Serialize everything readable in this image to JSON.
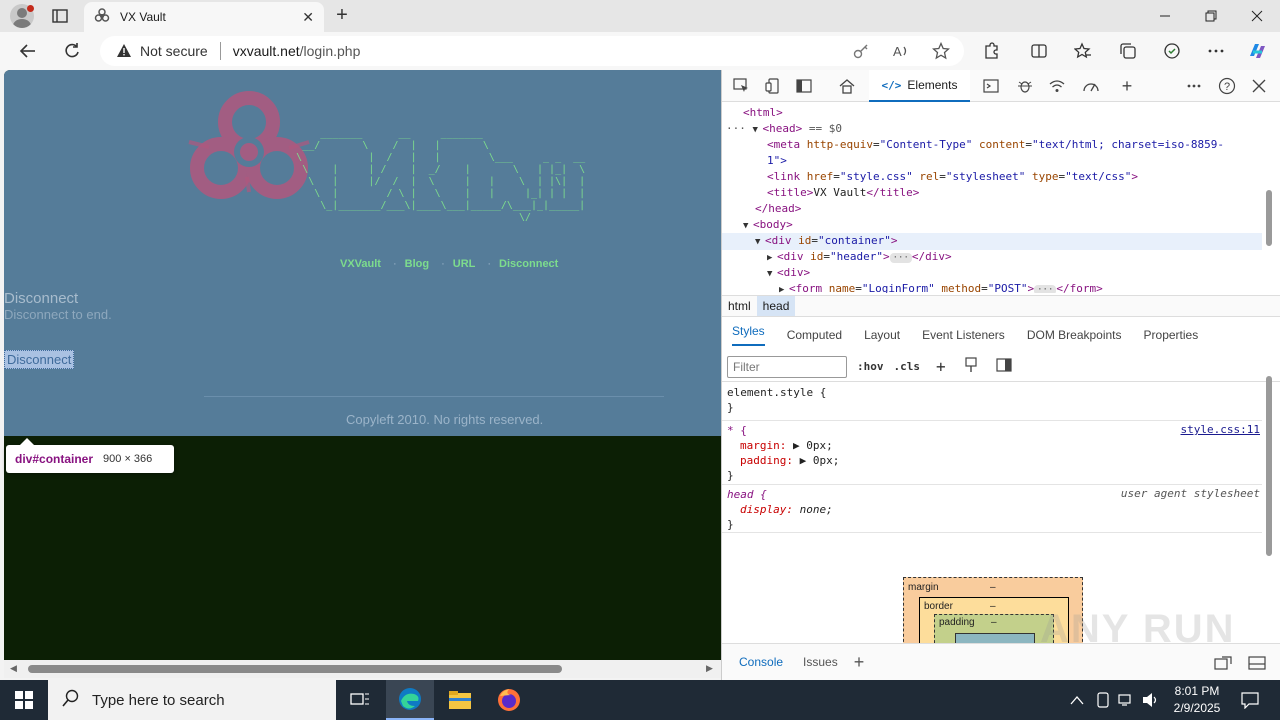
{
  "browser": {
    "tab_title": "VX Vault",
    "close_tab_glyph": "✕",
    "new_tab_glyph": "+",
    "security_label": "Not secure",
    "url_domain": "vxvault.net",
    "url_path": "/login.php"
  },
  "page": {
    "ascii_logo": "             _______      __     _______\n          __/       \\    /  |   |       \\\n         \\           |  /   |   |        \\___     _ _  __\n          \\    |     | /    |  _/    |       \\   | |_|  \\\n           \\   |     |/  /  |  \\     |   |    \\  | |\\|  |\n            \\  |        / \\ |   \\    |   |     |_| | |  |\n             \\_|_______/___\\|____\\___|_____/\\___|_|_____|\n                                              \\/",
    "nav": [
      "VXVault",
      "Blog",
      "URL",
      "Disconnect"
    ],
    "heading": "Disconnect",
    "subheading": "Disconnect to end.",
    "button": "Disconnect",
    "footer": "Copyleft 2010. No rights reserved.",
    "inspect_tooltip": {
      "tag": "div",
      "id": "#container",
      "dimensions": "900 × 366"
    }
  },
  "devtools": {
    "active_tab": "Elements",
    "dom_lines": {
      "html": "<html>",
      "head_eq": "== $0",
      "meta_equiv_value": "Content-Type",
      "meta_content_value": "text/html; charset=iso-8859-",
      "meta_cont": "1\">",
      "link_href": "style.css",
      "link_rel": "stylesheet",
      "link_type": "text/css",
      "title_text": "VX Vault",
      "div_container": "container",
      "div_header": "header",
      "form_name": "LoginForm",
      "form_method": "POST"
    },
    "breadcrumbs": [
      "html",
      "head"
    ],
    "style_tabs": [
      "Styles",
      "Computed",
      "Layout",
      "Event Listeners",
      "DOM Breakpoints",
      "Properties"
    ],
    "filter_placeholder": "Filter",
    "filter_opts": [
      ":hov",
      ".cls"
    ],
    "rules": {
      "element_style": "element.style {",
      "star_selector": "* {",
      "star_source": "style.css:11",
      "margin": "margin:",
      "margin_val": "0px;",
      "padding": "padding:",
      "padding_val": "0px;",
      "head_selector": "head {",
      "ua_label": "user agent stylesheet",
      "display": "display:",
      "display_val": "none;"
    },
    "boxmodel": {
      "margin_label": "margin",
      "border_label": "border",
      "padding_label": "padding",
      "dash": "–"
    },
    "drawer_tabs": [
      "Console",
      "Issues"
    ],
    "watermark": "ANY RUN"
  },
  "taskbar": {
    "search_placeholder": "Type here to search",
    "time": "8:01 PM",
    "date": "2/9/2025"
  },
  "colors": {
    "page_bg": "#557c99",
    "page_text": "#7ddc8d",
    "viewport_bg": "#0c1f05",
    "accent": "#0f6cbd"
  }
}
